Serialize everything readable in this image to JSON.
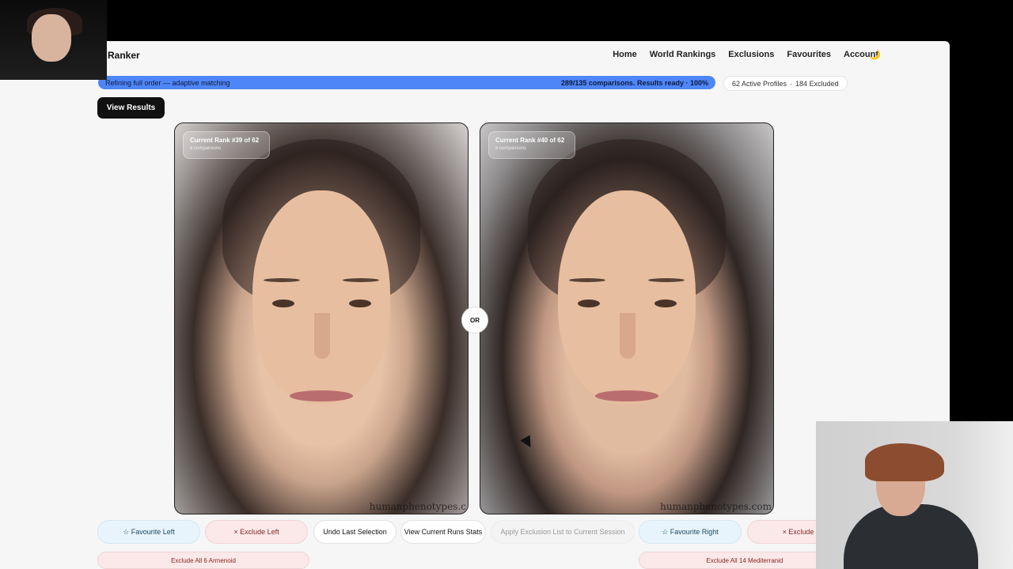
{
  "app": {
    "brand": "Ranker",
    "theme_icon": "moon-icon"
  },
  "nav": [
    "Home",
    "World Rankings",
    "Exclusions",
    "Favourites",
    "Account"
  ],
  "progress": {
    "label": "Refining full order — adaptive matching",
    "status": "289/135 comparisons. Results ready · 100%",
    "percent": 100
  },
  "profiles": {
    "active": "62 Active Profiles",
    "excluded": "184 Excluded"
  },
  "buttons": {
    "view_results": "View Results",
    "fav_left": "☆ Favourite Left",
    "excl_left": "× Exclude Left",
    "undo": "Undo Last Selection",
    "stats": "View Current Runs Stats",
    "apply": "Apply Exclusion List to Current Session",
    "fav_right": "☆ Favourite Right",
    "excl_right": "× Exclude Ri",
    "excl_all_left": "Exclude All 6 Armenoid",
    "excl_all_right": "Exclude All 14 Mediterranid"
  },
  "cards": {
    "left": {
      "rank": "Current Rank #39 of 62",
      "sub": "8 comparisons",
      "watermark": "humanphenotypes.c"
    },
    "right": {
      "rank": "Current Rank #40 of 62",
      "sub": "8 comparisons",
      "watermark": "humanphenotypes.com"
    }
  },
  "or_label": "OR"
}
